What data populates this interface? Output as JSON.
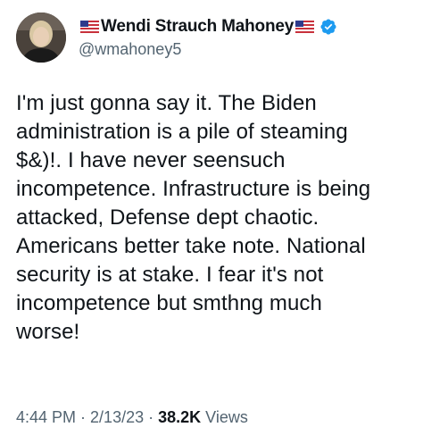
{
  "author": {
    "display_name": "Wendi Strauch Mahoney",
    "handle": "@wmahoney5",
    "avatar_icon": "profile-photo",
    "flag_icon": "us-flag-icon",
    "verified_icon": "verified-badge-icon",
    "verified_color": "#1d9bf0"
  },
  "tweet": {
    "text": "I'm just gonna say it. The Biden\nadministration is a pile of steaming\n$&)!. I have never seensuch\nincompetence. Infrastructure is being\nattacked, Defense dept chaotic.\nAmericans better take note. National\nsecurity is at stake. I fear it's not\nincompetence but smthng much\nworse!"
  },
  "meta": {
    "time": "4:44 PM",
    "sep1": " · ",
    "date": "2/13/23",
    "sep2": " · ",
    "views_count": "38.2K",
    "views_label": " Views"
  },
  "colors": {
    "text": "#0f1419",
    "secondary": "#536471"
  }
}
